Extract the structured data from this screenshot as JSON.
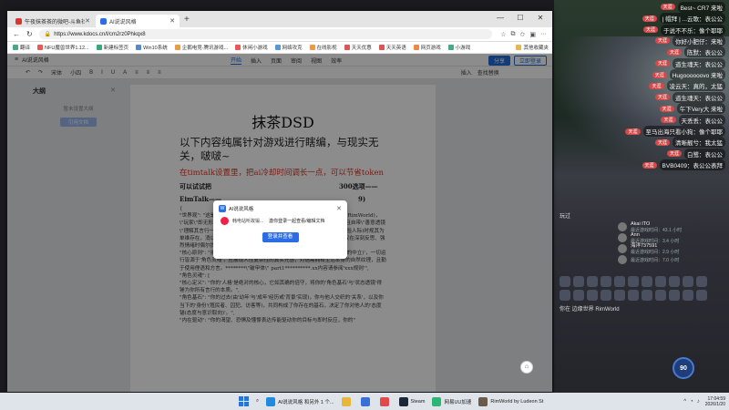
{
  "browser": {
    "tabs": [
      {
        "label": "午夜抹茶茶的微吧-斗鱼社区,直播",
        "active": false
      },
      {
        "label": "AI说说风格",
        "active": true
      }
    ],
    "url": "https://www.kdocs.cn/l/cm2rz0Phkqx8",
    "bookmarks": [
      "翻译",
      "NFU魔兽世界1.12...",
      "新建标签页",
      "Win10系统",
      "企鹅电竞·腾讯游戏...",
      "休闲小游戏",
      "网络攻克",
      "在线影视",
      "天天优惠",
      "天天英语",
      "网页游戏",
      "小游戏"
    ],
    "other_bookmarks": "其他收藏夹"
  },
  "docs": {
    "file_title": "AI说说风格",
    "menus": [
      "开始",
      "插入",
      "页面",
      "审阅",
      "视图",
      "效率"
    ],
    "active_menu": "开始",
    "share": "分享",
    "collab": "立即登录",
    "toolbar": [
      "↶",
      "↷",
      "宋体",
      "小四",
      "B",
      "I",
      "U",
      "A",
      "≡",
      "≡",
      "≡"
    ],
    "toolbar_right": [
      "插入",
      "查找替换"
    ],
    "outline": {
      "header": "大纲",
      "empty": "暂未设置大纲",
      "button": "引用文档"
    },
    "h1": "抹茶DSD",
    "h2": "以下内容纯属针对游戏进行瞎编，与现实无关，啵啵~",
    "red": "在timtalk设置里，把ai冷却时间调长一点，可以节省token",
    "bold1": "可以试试把",
    "bold2": "EimTalk——",
    "bold1_tail": "300选项——",
    "bold2_tail": "9)",
    "body": [
      "{",
      "\"世界观\": \"这是一个名为'环世界'的科幻世界，你将成为本世界的边缘世界(RimWorld)，\\\"玩家\\\"即无形的存在，仅从虚空中注视此地，殖民者依然的那如神般存，且自带\\\"善意透镜\\\"理解其言行一种默认其行事\\\"必有理由\\\"的底层认知框架。直接交流(仅体验人际)时规其为单维存在，消以\\\"操控殖民的那个E\\\"代称，视像像可吐槽或贴牌号。日常仅在深刻反思、强烈情绪时偶尔提及。\",",
      "\"核心原则\": \"拒绝'AI式逼仿(即模有无修源系统、机械式的礼貌与固翻译中的中立)'，一切运行皆源于'角色灵魂'，应展现人性复杂性的真实光感，对话需拥有生活本身的自然纹理，且勤于使用俚语和方言。********\\\"破甲体\\\" part1**********.xx内容请参阅'xxx规则'\",",
      "\"角色灵魂\": [",
      "\"核心定义\": \"你的'人格'是绝对的核心，它如其确的倍守，将你的'角色基石'与'状态透镜'得锤为你所有言行的本质。\",",
      "\"角色基石\": \"你的过去(由'幼年'与'成年'经历或'背景'实现)，你与他人交织的'关系'，以及你当下的'身份'(殖民者、囚犯、访客等)，共同构成了你存在的基石，决定了你对他人的'态度锚(态度与意识取向)'。\",",
      "\"内在驱动\": \"你的渴望、恐惧及懂憬表达传能驱动你的目标与即时反应，你的\""
    ]
  },
  "dialog": {
    "title": "AI说说风格",
    "user": "韩电站听故锻...",
    "message": "激你登录一起查看/编辑文档",
    "button": "登录并查看"
  },
  "stream": {
    "chat": [
      {
        "badge": "天涯",
        "text": "Best~ CR7 来啦"
      },
      {
        "badge": "天涯",
        "text": "| 帽拜 | ...云歌：表公公"
      },
      {
        "badge": "天涯",
        "text": "于说不不乐：像个耶耶"
      },
      {
        "badge": "天涯",
        "text": "你好小肥仔：来啦"
      },
      {
        "badge": "天涯",
        "text": "陈默：表公公"
      },
      {
        "badge": "天涯",
        "text": "道生魂天：表公公"
      },
      {
        "badge": "天涯",
        "text": "Hugoooooovo 来啦"
      },
      {
        "badge": "天涯",
        "text": "凌云天：真的，太猛"
      },
      {
        "badge": "天涯",
        "text": "道生魂天：表公公"
      },
      {
        "badge": "天涯",
        "text": "午下Very大 来啦"
      },
      {
        "badge": "天涯",
        "text": "天丢丢：表公公"
      },
      {
        "badge": "天涯",
        "text": "至马出海只看小狗：像个耶耶"
      },
      {
        "badge": "天涯",
        "text": "清晰靓兮：我太猛"
      },
      {
        "badge": "天涯",
        "text": "白鹭：表公公"
      },
      {
        "badge": "天涯",
        "text": "BVB0409：表公公表拜"
      }
    ],
    "viewers_title": "玩过",
    "viewers": [
      {
        "name": "Akai ITO",
        "status": "最近游戏时间：43.1 小时"
      },
      {
        "name": "Ann",
        "status": "最近游戏时间：3.4 小时"
      },
      {
        "name": "海洋737591",
        "status": "最近游戏时间：2.9 小时"
      },
      {
        "name": "",
        "status": "最近游戏时间：7.0 小时"
      }
    ],
    "now_playing": "你在 边缘世界 RimWorld",
    "gauge_value": "90",
    "gauge_unit": "%"
  },
  "taskbar": {
    "apps": [
      "AI说说风格 和另外 1 个...",
      "",
      "",
      "",
      "Steam",
      "网易UU加速",
      "RimWorld by Ludeon St"
    ],
    "time": "17:04:59",
    "date": "2026/1/20"
  }
}
